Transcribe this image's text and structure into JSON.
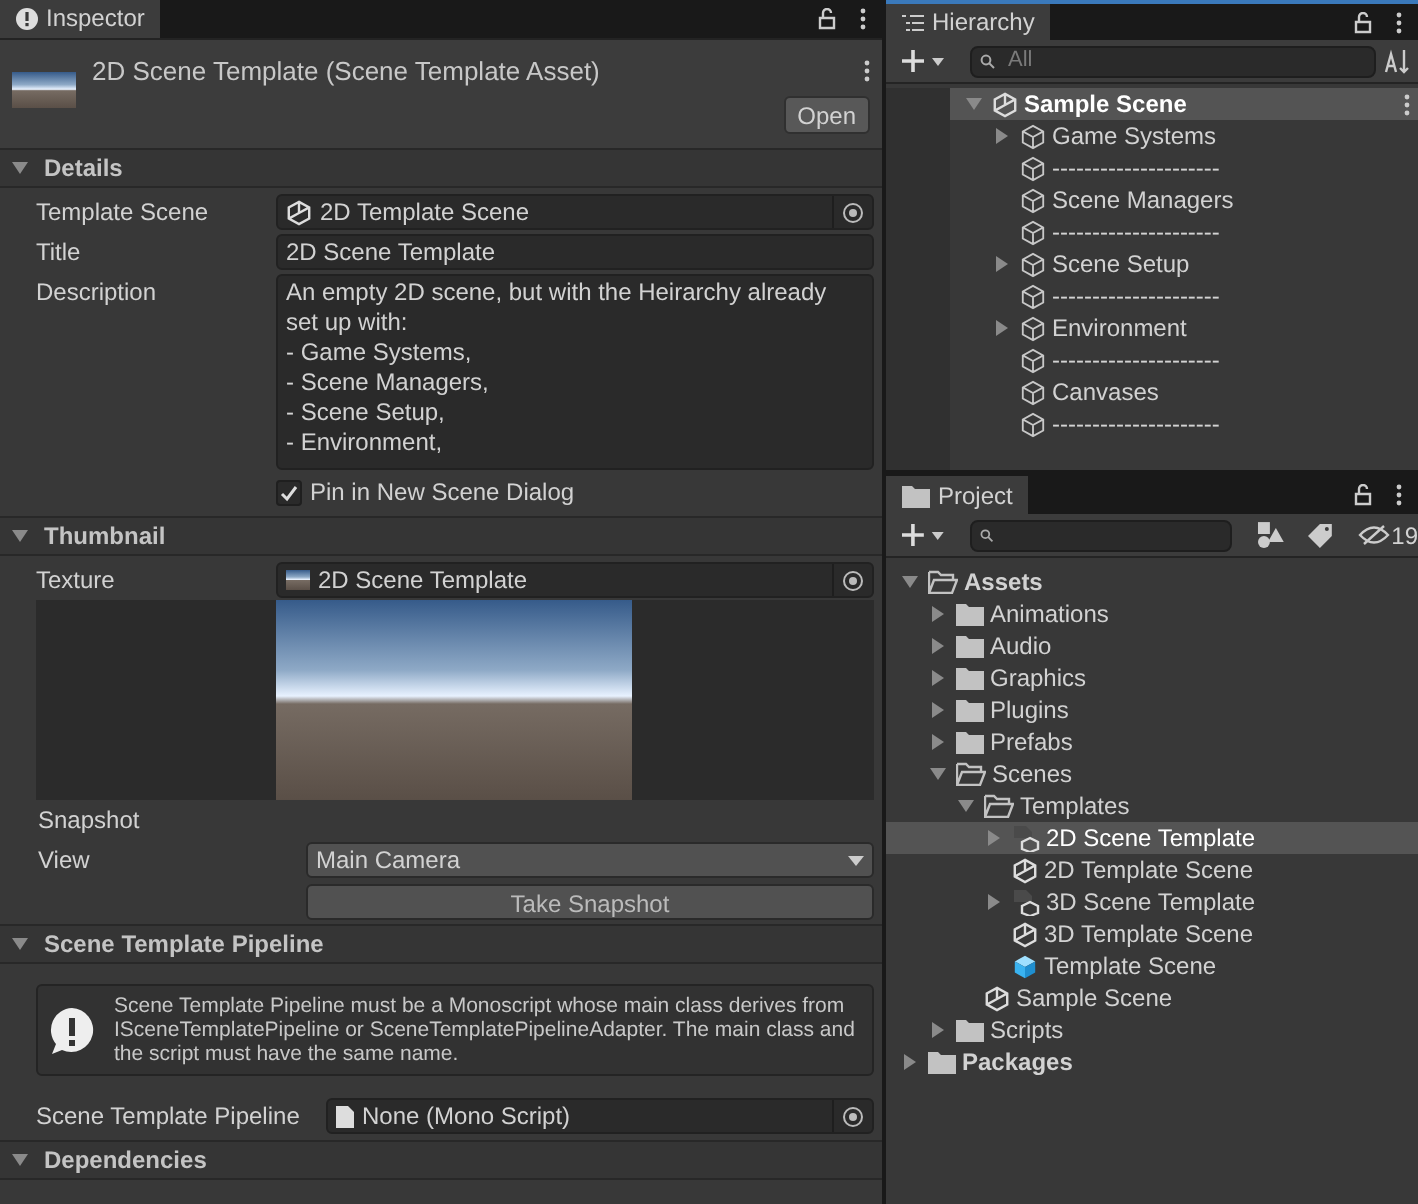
{
  "inspector": {
    "tab": "Inspector",
    "asset_title": "2D Scene Template (Scene Template Asset)",
    "open_button": "Open",
    "details": {
      "header": "Details",
      "template_scene_label": "Template Scene",
      "template_scene_value": "2D Template Scene",
      "title_label": "Title",
      "title_value": "2D Scene Template",
      "description_label": "Description",
      "description_lines": [
        "An empty 2D scene, but with the Heirarchy already",
        "set up with:",
        "- Game Systems,",
        "- Scene Managers,",
        "- Scene Setup,",
        "- Environment,"
      ],
      "pin": {
        "label": "Pin in New Scene Dialog",
        "checked": true
      }
    },
    "thumbnail": {
      "header": "Thumbnail",
      "texture_label": "Texture",
      "texture_value": "2D Scene Template",
      "snapshot_label": "Snapshot",
      "view_label": "View",
      "view_value": "Main Camera",
      "snapshot_button": "Take Snapshot"
    },
    "pipeline": {
      "header": "Scene Template Pipeline",
      "warning": "Scene Template Pipeline must be a Monoscript whose main class derives from ISceneTemplatePipeline or SceneTemplatePipelineAdapter. The main class and the script must have the same name.",
      "field_label": "Scene Template Pipeline",
      "field_value": "None (Mono Script)"
    },
    "dependencies": {
      "header": "Dependencies"
    }
  },
  "hierarchy": {
    "tab": "Hierarchy",
    "search_placeholder": "All",
    "items": [
      {
        "label": "Sample Scene",
        "kind": "scene",
        "expandable": true,
        "expanded": true,
        "selected": true,
        "children": [
          {
            "label": "Game Systems",
            "kind": "object",
            "expandable": true,
            "expanded": false,
            "selected": false
          },
          {
            "label": "---------------------",
            "kind": "object",
            "expandable": false,
            "selected": false
          },
          {
            "label": "Scene Managers",
            "kind": "object",
            "expandable": false,
            "selected": false
          },
          {
            "label": "---------------------",
            "kind": "object",
            "expandable": false,
            "selected": false
          },
          {
            "label": "Scene Setup",
            "kind": "object",
            "expandable": true,
            "expanded": false,
            "selected": false
          },
          {
            "label": "---------------------",
            "kind": "object",
            "expandable": false,
            "selected": false
          },
          {
            "label": "Environment",
            "kind": "object",
            "expandable": true,
            "expanded": false,
            "selected": false
          },
          {
            "label": "---------------------",
            "kind": "object",
            "expandable": false,
            "selected": false
          },
          {
            "label": "Canvases",
            "kind": "object",
            "expandable": false,
            "selected": false
          },
          {
            "label": "---------------------",
            "kind": "object",
            "expandable": false,
            "selected": false
          }
        ]
      }
    ]
  },
  "project": {
    "tab": "Project",
    "hidden_count": "19",
    "items": [
      {
        "label": "Assets",
        "kind": "folder",
        "expandable": true,
        "expanded": true,
        "selected": false,
        "children": [
          {
            "label": "Animations",
            "kind": "folder",
            "expandable": true,
            "expanded": false,
            "selected": false
          },
          {
            "label": "Audio",
            "kind": "folder",
            "expandable": true,
            "expanded": false,
            "selected": false
          },
          {
            "label": "Graphics",
            "kind": "folder",
            "expandable": true,
            "expanded": false,
            "selected": false
          },
          {
            "label": "Plugins",
            "kind": "folder",
            "expandable": true,
            "expanded": false,
            "selected": false
          },
          {
            "label": "Prefabs",
            "kind": "folder",
            "expandable": true,
            "expanded": false,
            "selected": false
          },
          {
            "label": "Scenes",
            "kind": "folder",
            "expandable": true,
            "expanded": true,
            "selected": false,
            "children": [
              {
                "label": "Templates",
                "kind": "folder",
                "expandable": true,
                "expanded": true,
                "selected": false,
                "children": [
                  {
                    "label": "2D Scene Template",
                    "kind": "template",
                    "expandable": true,
                    "expanded": false,
                    "selected": true
                  },
                  {
                    "label": "2D Template Scene",
                    "kind": "scene",
                    "expandable": false,
                    "selected": false
                  },
                  {
                    "label": "3D Scene Template",
                    "kind": "template",
                    "expandable": true,
                    "expanded": false,
                    "selected": false
                  },
                  {
                    "label": "3D Template Scene",
                    "kind": "scene",
                    "expandable": false,
                    "selected": false
                  },
                  {
                    "label": "Template Scene",
                    "kind": "prefab",
                    "expandable": false,
                    "selected": false
                  }
                ]
              },
              {
                "label": "Sample Scene",
                "kind": "scene",
                "expandable": false,
                "selected": false
              }
            ]
          },
          {
            "label": "Scripts",
            "kind": "folder",
            "expandable": true,
            "expanded": false,
            "selected": false
          }
        ]
      },
      {
        "label": "Packages",
        "kind": "folder",
        "expandable": true,
        "expanded": false,
        "selected": false
      }
    ]
  }
}
